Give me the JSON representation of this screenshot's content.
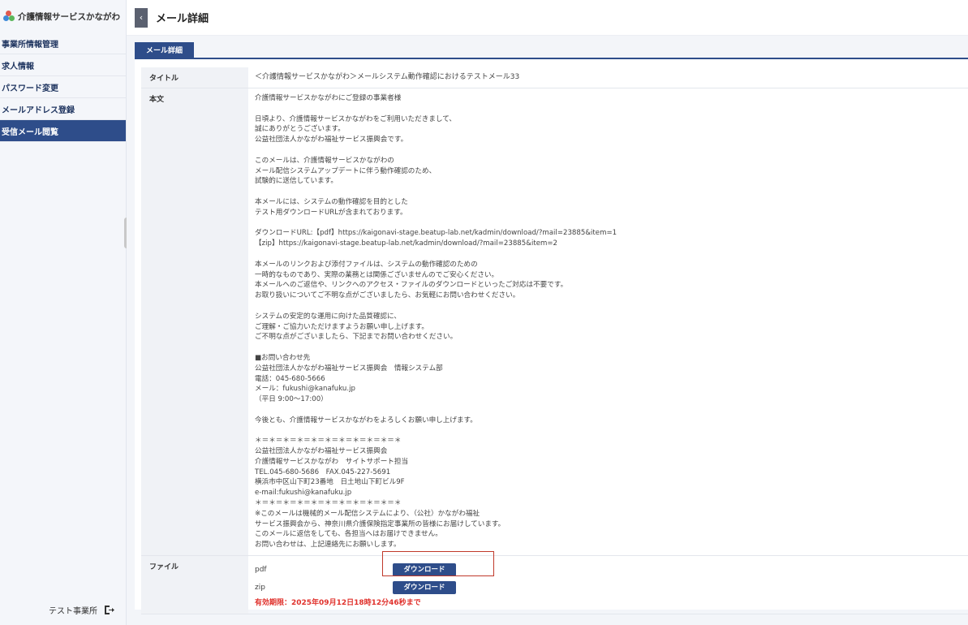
{
  "app": {
    "logo_text": "介護情報サービスかながわ"
  },
  "sidebar": {
    "items": [
      {
        "label": "事業所情報管理"
      },
      {
        "label": "求人情報"
      },
      {
        "label": "パスワード変更"
      },
      {
        "label": "メールアドレス登録"
      },
      {
        "label": "受信メール閲覧",
        "active": true
      }
    ],
    "user_name": "テスト事業所"
  },
  "header": {
    "back_icon": "chevron-left-icon",
    "title": "メール詳細"
  },
  "tab": {
    "label": "メール詳細"
  },
  "detail": {
    "title_label": "タイトル",
    "title_value": "＜介護情報サービスかながわ＞メールシステム動作確認におけるテストメール33",
    "body_label": "本文",
    "body_text": "介護情報サービスかながわにご登録の事業者様\n\n日頃より、介護情報サービスかながわをご利用いただきまして、\n誠にありがとうございます。\n公益社団法人かながわ福祉サービス振興会です。\n\nこのメールは、介護情報サービスかながわの\nメール配信システムアップデートに伴う動作確認のため、\n試験的に送信しています。\n\n本メールには、システムの動作確認を目的とした\nテスト用ダウンロードURLが含まれております。\n\nダウンロードURL:【pdf】https://kaigonavi-stage.beatup-lab.net/kadmin/download/?mail=23885&item=1\n【zip】https://kaigonavi-stage.beatup-lab.net/kadmin/download/?mail=23885&item=2\n\n本メールのリンクおよび添付ファイルは、システムの動作確認のための\n一時的なものであり、実際の業務とは関係ございませんのでご安心ください。\n本メールへのご返信や、リンクへのアクセス・ファイルのダウンロードといったご対応は不要です。\nお取り扱いについてご不明な点がございましたら、お気軽にお問い合わせください。\n\nシステムの安定的な運用に向けた品質確認に、\nご理解・ご協力いただけますようお願い申し上げます。\nご不明な点がございましたら、下記までお問い合わせください。\n\n■お問い合わせ先\n公益社団法人かながわ福祉サービス振興会　情報システム部\n電話：045-680-5666\nメール：fukushi@kanafuku.jp\n（平日 9:00〜17:00）\n\n今後とも、介護情報サービスかながわをよろしくお願い申し上げます。\n\n＊＝＊＝＊＝＊＝＊＝＊＝＊＝＊＝＊＝＊＝＊\n公益社団法人かながわ福祉サービス振興会\n介護情報サービスかながわ　サイトサポート担当\nTEL.045-680-5686　FAX.045-227-5691\n横浜市中区山下町23番地　日土地山下町ビル9F\ne-mail:fukushi@kanafuku.jp\n＊＝＊＝＊＝＊＝＊＝＊＝＊＝＊＝＊＝＊＝＊\n※このメールは機械的メール配信システムにより、（公社）かながわ福祉\nサービス振興会から、神奈川県介護保険指定事業所の皆様にお届けしています。\nこのメールに返信をしても、各担当へはお届けできません。\nお問い合わせは、上記連絡先にお願いします。",
    "file_label": "ファイル",
    "files": [
      {
        "name": "pdf",
        "button": "ダウンロード"
      },
      {
        "name": "zip",
        "button": "ダウンロード"
      }
    ],
    "expiry": "有効期限：2025年09月12日18時12分46秒まで"
  }
}
